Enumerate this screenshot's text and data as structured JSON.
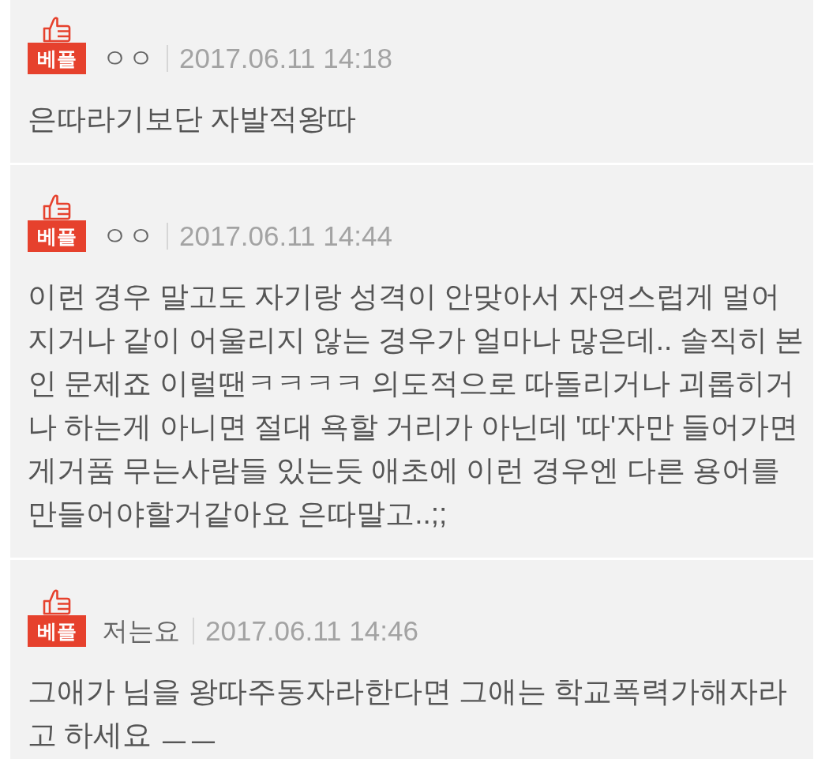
{
  "comments": [
    {
      "badge": "베플",
      "author": "ㅇㅇ",
      "date": "2017.06.11 14:18",
      "text": "은따라기보단 자발적왕따"
    },
    {
      "badge": "베플",
      "author": "ㅇㅇ",
      "date": "2017.06.11 14:44",
      "text": "이런 경우 말고도 자기랑 성격이 안맞아서 자연스럽게 멀어지거나 같이 어울리지 않는 경우가 얼마나 많은데.. 솔직히 본인 문제죠 이럴땐ㅋㅋㅋㅋ 의도적으로 따돌리거나 괴롭히거나 하는게 아니면 절대 욕할 거리가 아닌데 '따'자만 들어가면 게거품 무는사람들 있는듯 애초에 이런 경우엔 다른 용어를 만들어야할거같아요 은따말고..;;"
    },
    {
      "badge": "베플",
      "author": "저는요",
      "date": "2017.06.11 14:46",
      "text": "그애가 님을 왕따주동자라한다면 그애는 학교폭력가해자라고 하세요 ㅡㅡ"
    }
  ]
}
